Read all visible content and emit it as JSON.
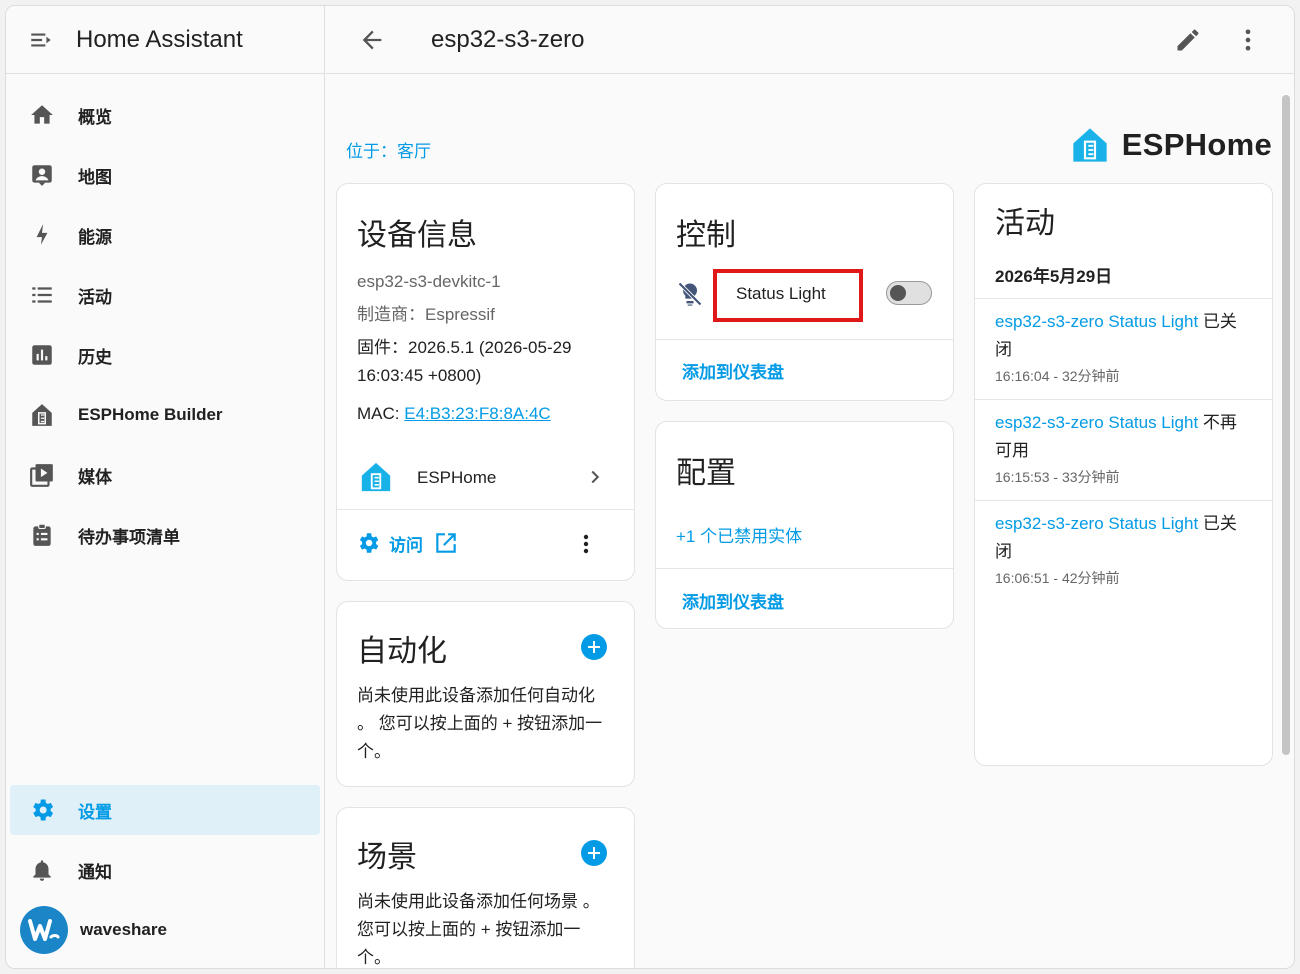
{
  "sidebar": {
    "title": "Home Assistant",
    "items": [
      {
        "label": "概览",
        "icon": "home-icon"
      },
      {
        "label": "地图",
        "icon": "map-icon"
      },
      {
        "label": "能源",
        "icon": "lightning-icon"
      },
      {
        "label": "活动",
        "icon": "list-icon"
      },
      {
        "label": "历史",
        "icon": "chart-icon"
      },
      {
        "label": "ESPHome Builder",
        "icon": "esphome-icon"
      },
      {
        "label": "媒体",
        "icon": "media-icon"
      },
      {
        "label": "待办事项清单",
        "icon": "clipboard-list-icon"
      }
    ],
    "settings_label": "设置",
    "notifications_label": "通知",
    "user_name": "waveshare"
  },
  "header": {
    "device_name": "esp32-s3-zero"
  },
  "location": "位于：客厅",
  "brand_name": "ESPHome",
  "device_info": {
    "title": "设备信息",
    "model": "esp32-s3-devkitc-1",
    "manufacturer": "制造商：Espressif",
    "firmware_line1": "固件：2026.5.1 (2026-05-29",
    "firmware_line2": "16:03:45 +0800)",
    "mac_label": "MAC: ",
    "mac_value": "E4:B3:23:F8:8A:4C",
    "integration_name": "ESPHome",
    "visit_label": "访问"
  },
  "automation": {
    "title": "自动化",
    "text_1": "尚未使用此设备添加任何自动化",
    "text_2": "。 您可以按上面的 + 按钮添加一",
    "text_3": "个。"
  },
  "scene": {
    "title": "场景",
    "text_1": "尚未使用此设备添加任何场景 。",
    "text_2": "您可以按上面的 + 按钮添加一",
    "text_3": "个。"
  },
  "controls": {
    "title": "控制",
    "entity_name": "Status Light",
    "toggle_state": "off",
    "add_to_dashboard": "添加到仪表盘"
  },
  "config": {
    "title": "配置",
    "disabled_entities": "+1 个已禁用实体",
    "add_to_dashboard": "添加到仪表盘"
  },
  "activity": {
    "title": "活动",
    "date": "2026年5月29日",
    "entries": [
      {
        "entity": "esp32-s3-zero Status Light",
        "action_1": " 已关",
        "action_2": "闭",
        "time": "16:16:04 - 32分钟前"
      },
      {
        "entity": "esp32-s3-zero Status Light",
        "action_1": " 不再",
        "action_2": "可用",
        "time": "16:15:53 - 33分钟前"
      },
      {
        "entity": "esp32-s3-zero Status Light",
        "action_1": " 已关",
        "action_2": "闭",
        "time": "16:06:51 - 42分钟前"
      }
    ]
  },
  "colors": {
    "accent": "#039be5",
    "highlight": "#e01818",
    "active_nav_bg": "#dff0f8"
  }
}
